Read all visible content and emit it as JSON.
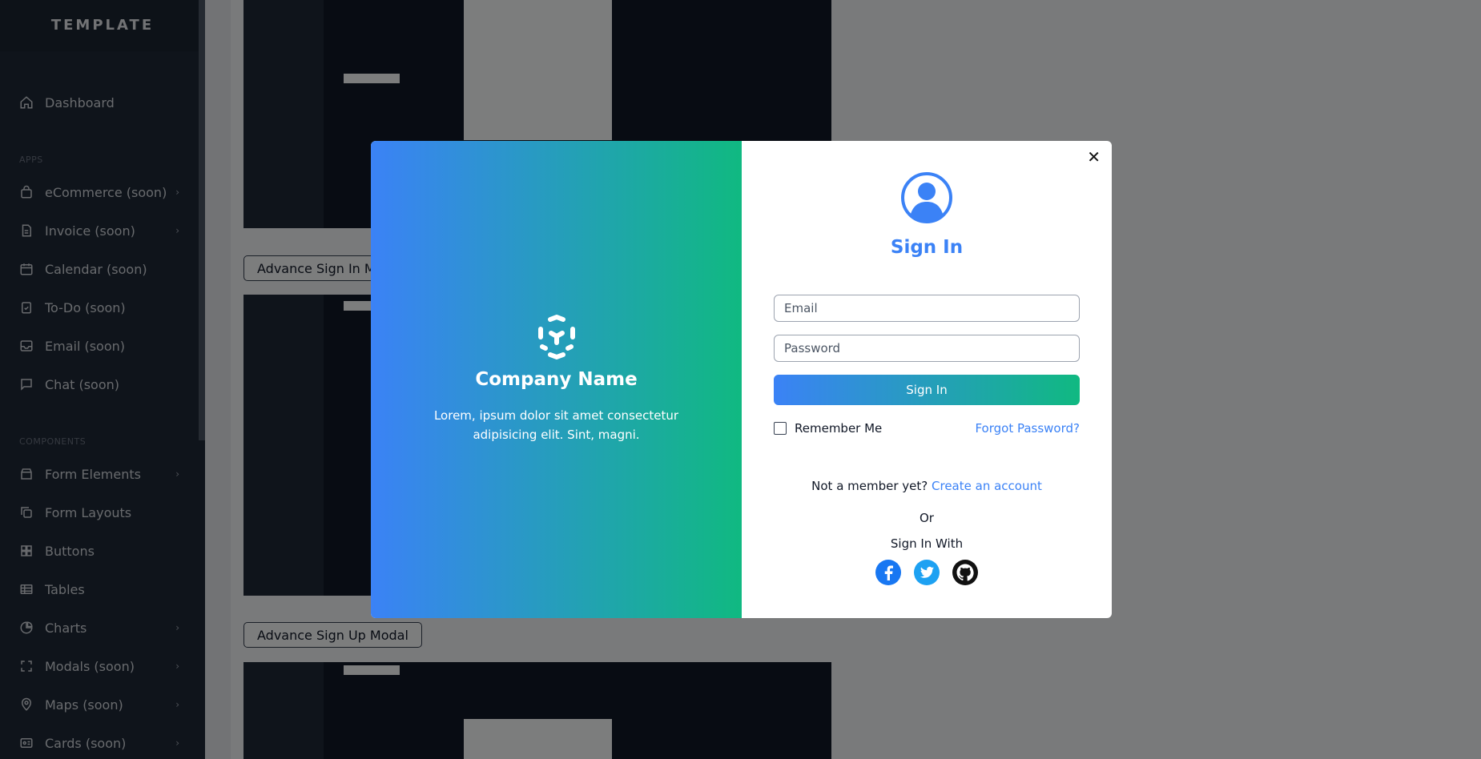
{
  "sidebar": {
    "brand": "TEMPLATE",
    "dashboard": "Dashboard",
    "section_apps": "APPS",
    "apps": [
      {
        "label": "eCommerce (soon)"
      },
      {
        "label": "Invoice (soon)"
      },
      {
        "label": "Calendar (soon)"
      },
      {
        "label": "To-Do (soon)"
      },
      {
        "label": "Email (soon)"
      },
      {
        "label": "Chat (soon)"
      }
    ],
    "section_components": "COMPONENTS",
    "components": [
      {
        "label": "Form Elements"
      },
      {
        "label": "Form Layouts"
      },
      {
        "label": "Buttons"
      },
      {
        "label": "Tables"
      },
      {
        "label": "Charts"
      },
      {
        "label": "Modals (soon)"
      },
      {
        "label": "Maps (soon)"
      },
      {
        "label": "Cards (soon)"
      }
    ]
  },
  "main": {
    "buttons": {
      "advance_sign_in": "Advance Sign In Modal",
      "advance_sign_up": "Advance Sign Up Modal"
    }
  },
  "modal": {
    "company_name": "Company Name",
    "company_desc": "Lorem, ipsum dolor sit amet consectetur adipisicing elit. Sint, magni.",
    "title": "Sign In",
    "email_placeholder": "Email",
    "password_placeholder": "Password",
    "sign_in_button": "Sign In",
    "remember_me": "Remember Me",
    "forgot_password": "Forgot Password?",
    "not_member": "Not a member yet?",
    "create_account": "Create an account",
    "or": "Or",
    "sign_in_with": "Sign In With",
    "close_glyph": "✕"
  },
  "colors": {
    "accent": "#3b82f6",
    "gradient_end": "#10b981",
    "sidebar_bg": "#1f2937"
  }
}
